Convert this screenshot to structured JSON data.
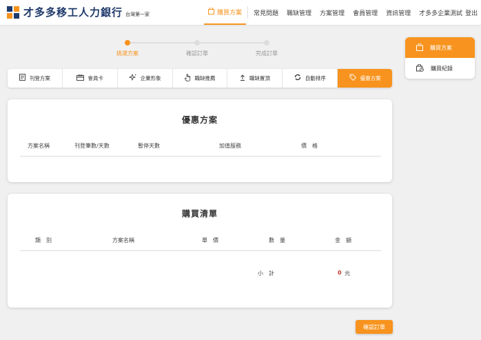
{
  "brand": {
    "name": "才多多移工人力銀行",
    "tagline": "台灣第一家",
    "colors": {
      "accent": "#f7931e",
      "navy": "#1f3a6b"
    }
  },
  "nav": {
    "items": [
      {
        "label": "購買方案",
        "icon": "bag-icon",
        "active": true
      },
      {
        "label": "常見問題"
      },
      {
        "label": "職缺管理"
      },
      {
        "label": "方案管理"
      },
      {
        "label": "會員管理"
      },
      {
        "label": "資訊管理"
      }
    ],
    "user": "才多多企業測試",
    "logout": "登出"
  },
  "stepper": {
    "steps": [
      "挑選方案",
      "確認訂單",
      "完成訂單"
    ],
    "current": 1
  },
  "tabs": [
    {
      "label": "刊登方案",
      "icon": "document-icon"
    },
    {
      "label": "會員卡",
      "icon": "card-icon"
    },
    {
      "label": "企業形象",
      "icon": "sparkle-icon"
    },
    {
      "label": "職缺推薦",
      "icon": "hand-icon"
    },
    {
      "label": "職缺置頂",
      "icon": "arrow-up-icon"
    },
    {
      "label": "自動排序",
      "icon": "refresh-icon"
    },
    {
      "label": "優惠方案",
      "icon": "tag-icon",
      "active": true
    }
  ],
  "discount": {
    "title": "優惠方案",
    "columns": [
      "方案名稱",
      "刊登筆數/天數",
      "暫停天數",
      "加值服務",
      "價　格"
    ]
  },
  "cart": {
    "title": "購買清單",
    "columns": [
      "類　別",
      "方案名稱",
      "單　價",
      "數　量",
      "金　額"
    ],
    "subtotal_label": "小　計",
    "subtotal_value": "0",
    "currency": "元"
  },
  "sidebar": {
    "items": [
      {
        "label": "購買方案",
        "icon": "bag-icon",
        "active": true
      },
      {
        "label": "購買紀錄",
        "icon": "history-bag-icon"
      }
    ]
  },
  "confirm_button": "確認訂單"
}
